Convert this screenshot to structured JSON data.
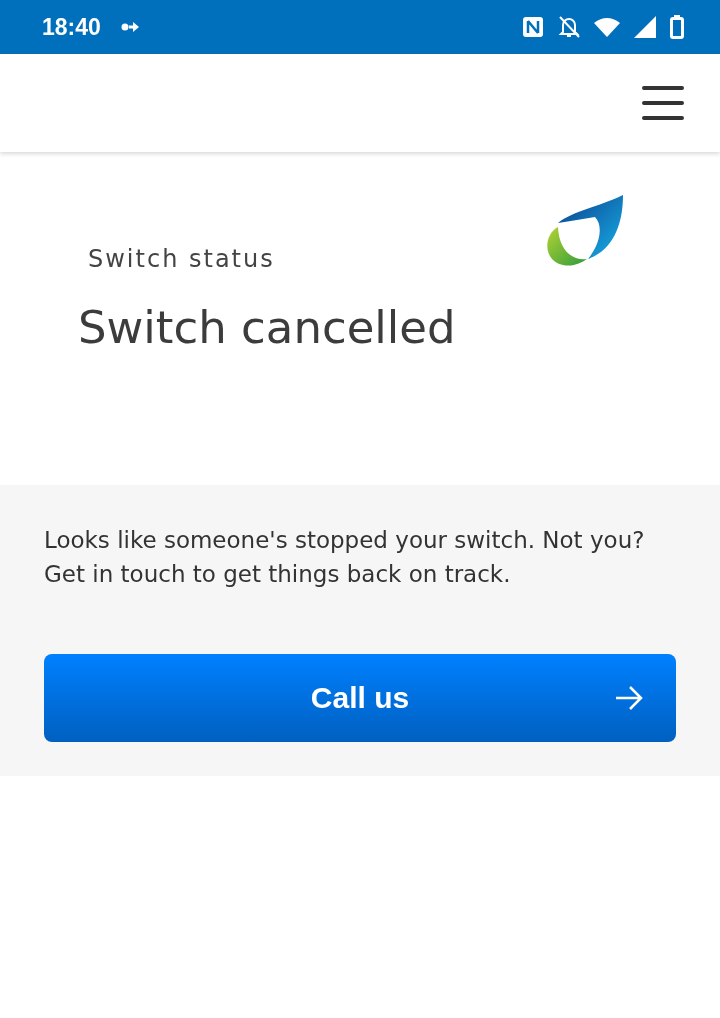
{
  "status_bar": {
    "time": "18:40"
  },
  "status": {
    "label": "Switch status",
    "title": "Switch cancelled"
  },
  "notice": {
    "message": "Looks like someone's stopped your switch. Not you? Get in touch to get things back on track.",
    "button": "Call us"
  }
}
